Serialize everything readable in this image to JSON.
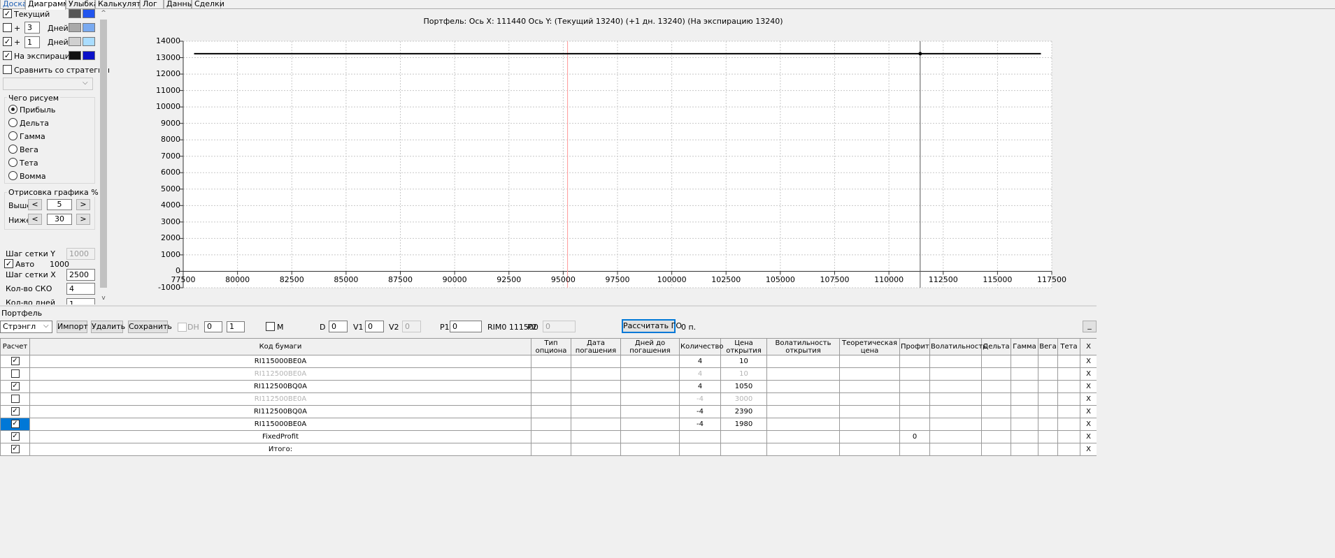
{
  "tabs": [
    "Доска",
    "Диаграмма",
    "Улыбка",
    "Калькулятор",
    "Лог",
    "Данные",
    "Сделки"
  ],
  "left": {
    "current": {
      "label": "Текущий",
      "checked": "✓"
    },
    "plus1": {
      "plus": "+",
      "value": "3",
      "unit": "Дней"
    },
    "plus2": {
      "plus": "+",
      "value": "1",
      "unit": "Дней",
      "checked": "✓"
    },
    "expiry": {
      "label": "На экспирацию",
      "checked": "✓"
    },
    "compare": {
      "label": "Сравнить со стратегией"
    },
    "draw_group": {
      "title": "Чего рисуем",
      "options": [
        "Прибыль",
        "Дельта",
        "Гамма",
        "Вега",
        "Тета",
        "Вомма"
      ]
    },
    "render_group": {
      "title": "Отрисовка графика %",
      "above_label": "Выше",
      "above_value": "5",
      "below_label": "Ниже",
      "below_value": "30",
      "prev": "<",
      "next": ">"
    },
    "grid_y": {
      "label": "Шаг сетки Y",
      "value": "1000"
    },
    "auto": {
      "label": "Авто",
      "value": "1000",
      "checked": "✓"
    },
    "grid_x": {
      "label": "Шаг сетки X",
      "value": "2500"
    },
    "sko": {
      "label": "Кол-во СКО",
      "value": "4"
    },
    "days": {
      "label": "Кол-во дней",
      "value": "1"
    },
    "colors": {
      "current_a": "#555555",
      "current_b": "#2255ee",
      "plus1_a": "#a9a9a9",
      "plus1_b": "#7aaaf0",
      "plus2_a": "#d0d0d0",
      "plus2_b": "#aaddff",
      "expiry_a": "#111111",
      "expiry_b": "#0a10c8"
    }
  },
  "chart": {
    "title": "Портфель: Ось X: 111440 Ось Y:  (Текущий 13240)  (+1 дн. 13240)  (На экспирацию 13240)"
  },
  "chart_data": {
    "type": "line",
    "title": "Портфель: Ось X: 111440 Ось Y:  (Текущий 13240)  (+1 дн. 13240)  (На экспирацию 13240)",
    "xlim": [
      77500,
      117500
    ],
    "ylim": [
      -1000,
      14000
    ],
    "x_ticks": [
      77500,
      80000,
      82500,
      85000,
      87500,
      90000,
      92500,
      95000,
      97500,
      100000,
      102500,
      105000,
      107500,
      110000,
      112500,
      115000,
      117500
    ],
    "y_ticks": [
      -1000,
      0,
      1000,
      2000,
      3000,
      4000,
      5000,
      6000,
      7000,
      8000,
      9000,
      10000,
      11000,
      12000,
      13000,
      14000
    ],
    "series": [
      {
        "x": [
          78000,
          117000
        ],
        "values": [
          13240,
          13240
        ],
        "color": "#000000"
      }
    ],
    "vertical_lines": [
      {
        "x": 95200,
        "color": "#ff9999"
      },
      {
        "x": 111440,
        "color": "#555555"
      }
    ],
    "marker": {
      "x": 111440,
      "y": 13240
    },
    "grid": true
  },
  "portfolio": {
    "label": "Портфель",
    "strategy": "Стрэнгл",
    "import": "Импорт",
    "delete": "Удалить",
    "save": "Сохранить",
    "dh": "DH",
    "dh_a": "0",
    "dh_b": "1",
    "m": "M",
    "d_label": "D",
    "d_value": "0",
    "v1_label": "V1",
    "v1_value": "0",
    "v2_label": "V2",
    "v2_value": "0",
    "p1_label": "P1",
    "p1_value": "0",
    "rim": "RIM0 111500",
    "p2_label": "P2",
    "p2_value": "0",
    "calc_go": "Рассчитать ГО",
    "points": "0 п.",
    "minimize": "_"
  },
  "table": {
    "headers": [
      "Расчет",
      "Код бумаги",
      "Тип опциона",
      "Дата погашения",
      "Дней до погашения",
      "Количество",
      "Цена открытия",
      "Волатильность открытия",
      "Теоретическая цена",
      "Профит",
      "Волатильность",
      "Дельта",
      "Гамма",
      "Вега",
      "Тета",
      "X"
    ],
    "rows": [
      {
        "check": "✓",
        "code": "RI115000BE0A",
        "qty": "4",
        "price": "10",
        "profit": "",
        "grey": false,
        "sel": false
      },
      {
        "check": "",
        "code": "RI112500BE0A",
        "qty": "4",
        "price": "10",
        "profit": "",
        "grey": true,
        "sel": false
      },
      {
        "check": "✓",
        "code": "RI112500BQ0A",
        "qty": "4",
        "price": "1050",
        "profit": "",
        "grey": false,
        "sel": false
      },
      {
        "check": "",
        "code": "RI112500BE0A",
        "qty": "-4",
        "price": "3000",
        "profit": "",
        "grey": true,
        "sel": false
      },
      {
        "check": "✓",
        "code": "RI112500BQ0A",
        "qty": "-4",
        "price": "2390",
        "profit": "",
        "grey": false,
        "sel": false
      },
      {
        "check": "✓",
        "code": "RI115000BE0A",
        "qty": "-4",
        "price": "1980",
        "profit": "",
        "grey": false,
        "sel": true
      },
      {
        "check": "✓",
        "code": "FixedProfit",
        "qty": "",
        "price": "",
        "profit": "0",
        "grey": false,
        "sel": false
      },
      {
        "check": "✓",
        "code": "Итого:",
        "qty": "",
        "price": "",
        "profit": "",
        "grey": false,
        "sel": false
      }
    ],
    "x": "X"
  }
}
